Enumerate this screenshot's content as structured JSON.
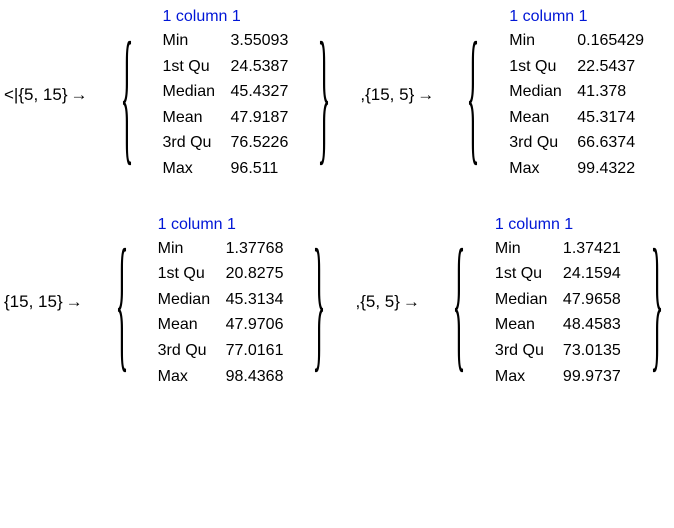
{
  "open_delim": "<|",
  "close_delim": "|>",
  "comma": ",",
  "arrow": "→",
  "header_label": "1 column 1",
  "stat_labels": [
    "Min",
    "1st Qu",
    "Median",
    "Mean",
    "3rd Qu",
    "Max"
  ],
  "entries": [
    {
      "key": "{5, 15}",
      "values": [
        "3.55093",
        "24.5387",
        "45.4327",
        "47.9187",
        "76.5226",
        "96.511"
      ]
    },
    {
      "key": "{15, 5}",
      "values": [
        "0.165429",
        "22.5437",
        "41.378",
        "45.3174",
        "66.6374",
        "99.4322"
      ]
    },
    {
      "key": "{15, 15}",
      "values": [
        "1.37768",
        "20.8275",
        "45.3134",
        "47.9706",
        "77.0161",
        "98.4368"
      ]
    },
    {
      "key": "{5, 5}",
      "values": [
        "1.37421",
        "24.1594",
        "47.9658",
        "48.4583",
        "73.0135",
        "99.9737"
      ]
    }
  ]
}
